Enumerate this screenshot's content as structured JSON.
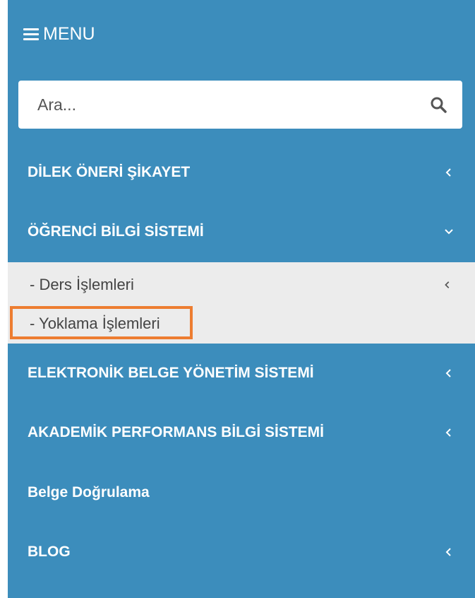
{
  "header": {
    "menu_label": "MENU"
  },
  "search": {
    "placeholder": "Ara..."
  },
  "nav": {
    "items": [
      {
        "label": "DİLEK ÖNERİ ŞİKAYET",
        "chevron": "chevron-left"
      },
      {
        "label": "ÖĞRENCİ BİLGİ SİSTEMİ",
        "chevron": "chevron-down"
      },
      {
        "label": "ELEKTRONİK BELGE YÖNETİM SİSTEMİ",
        "chevron": "chevron-left"
      },
      {
        "label": "AKADEMİK PERFORMANS BİLGİ SİSTEMİ",
        "chevron": "chevron-left"
      },
      {
        "label": "Belge Doğrulama",
        "chevron": ""
      },
      {
        "label": "BLOG",
        "chevron": "chevron-left"
      }
    ],
    "submenu": [
      {
        "label": "- Ders İşlemleri",
        "chevron": "chevron-left"
      },
      {
        "label": "- Yoklama İşlemleri",
        "chevron": ""
      }
    ]
  },
  "colors": {
    "sidebar_bg": "#3c8dbc",
    "submenu_bg": "#ececec",
    "highlight_border": "#ed7d31"
  }
}
